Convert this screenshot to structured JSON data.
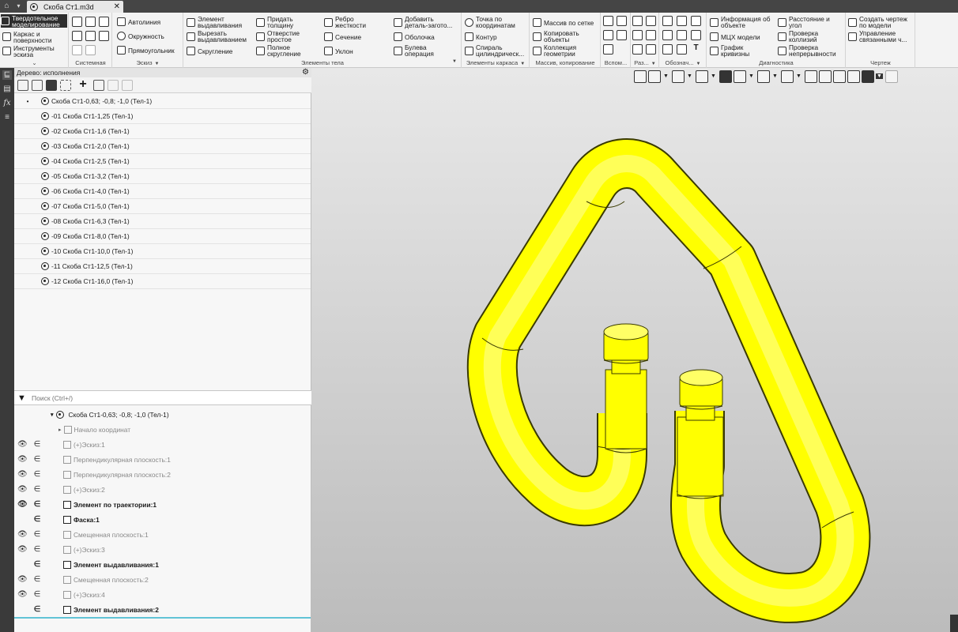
{
  "tabbar": {
    "home_icon": "home-icon",
    "doc_title": "Скоба Ст1.m3d",
    "close": "✕"
  },
  "ribbon": {
    "modes": {
      "m1": "Твердотельное моделирование",
      "m2": "Каркас и поверхности",
      "m3": "Инструменты эскиза"
    },
    "system": {
      "label": "Системная"
    },
    "sketch": {
      "autoline": "Автолиния",
      "circle": "Окружность",
      "rect": "Прямоугольник",
      "label": "Эскиз"
    },
    "body": {
      "extrude": "Элемент выдавливания",
      "cut": "Вырезать выдавливанием",
      "fillet": "Скругление",
      "thicken": "Придать толщину",
      "hole": "Отверстие простое",
      "full_fillet": "Полное скругление",
      "rib": "Ребро жесткости",
      "section": "Сечение",
      "draft": "Уклон",
      "add_blank": "Добавить деталь-загото...",
      "shell": "Оболочка",
      "boolean": "Булева операция",
      "label": "Элементы тела"
    },
    "wire": {
      "point": "Точка по координатам",
      "contour": "Контур",
      "spiral": "Спираль цилиндрическ...",
      "label": "Элементы каркаса"
    },
    "array": {
      "grid": "Массив по сетке",
      "copy": "Копировать объекты",
      "collection": "Коллекция геометрии",
      "label": "Массив, копирование"
    },
    "aux": {
      "label": "Вспом..."
    },
    "sizes": {
      "label": "Раз..."
    },
    "notes": {
      "label": "Обознач..."
    },
    "diag": {
      "info": "Информация об объекте",
      "mcc": "МЦХ модели",
      "curvature": "График кривизны",
      "distance": "Расстояние и угол",
      "collision": "Проверка коллизий",
      "continuity": "Проверка непрерывности",
      "label": "Диагностика"
    },
    "drawing": {
      "create": "Создать чертеж по модели",
      "manage": "Управление связанными ч...",
      "label": "Чертеж"
    }
  },
  "tree_header": {
    "title": "Дерево: исполнения"
  },
  "variants": [
    {
      "mark": "•",
      "name": "Скоба Ст1-0,63; -0,8; -1,0 (Тел-1)"
    },
    {
      "mark": "",
      "name": "-01 Скоба Ст1-1,25 (Тел-1)"
    },
    {
      "mark": "",
      "name": "-02 Скоба Ст1-1,6 (Тел-1)"
    },
    {
      "mark": "",
      "name": "-03 Скоба Ст1-2,0 (Тел-1)"
    },
    {
      "mark": "",
      "name": "-04 Скоба Ст1-2,5 (Тел-1)"
    },
    {
      "mark": "",
      "name": "-05 Скоба Ст1-3,2 (Тел-1)"
    },
    {
      "mark": "",
      "name": "-06 Скоба Ст1-4,0 (Тел-1)"
    },
    {
      "mark": "",
      "name": "-07 Скоба Ст1-5,0 (Тел-1)"
    },
    {
      "mark": "",
      "name": "-08 Скоба Ст1-6,3 (Тел-1)"
    },
    {
      "mark": "",
      "name": "-09 Скоба Ст1-8,0 (Тел-1)"
    },
    {
      "mark": "",
      "name": "-10 Скоба Ст1-10,0 (Тел-1)"
    },
    {
      "mark": "",
      "name": "-11 Скоба Ст1-12,5 (Тел-1)"
    },
    {
      "mark": "",
      "name": "-12 Скоба Ст1-16,0 (Тел-1)"
    }
  ],
  "search": {
    "placeholder": "Поиск (Ctrl+/)"
  },
  "tree": {
    "root": "Скоба Ст1-0,63; -0,8; -1,0 (Тел-1)",
    "items": [
      {
        "label": "Начало координат",
        "bold": false,
        "eye": "",
        "elem": ""
      },
      {
        "label": "(+)Эскиз:1",
        "bold": false,
        "eye": "👁",
        "elem": "∈"
      },
      {
        "label": "Перпендикулярная плоскость:1",
        "bold": false,
        "eye": "👁",
        "elem": "∈"
      },
      {
        "label": "Перпендикулярная плоскость:2",
        "bold": false,
        "eye": "👁",
        "elem": "∈"
      },
      {
        "label": "(+)Эскиз:2",
        "bold": false,
        "eye": "👁",
        "elem": "∈"
      },
      {
        "label": "Элемент по траектории:1",
        "bold": true,
        "eye": "👁",
        "elem": "∈"
      },
      {
        "label": "Фаска:1",
        "bold": true,
        "eye": "",
        "elem": "∈"
      },
      {
        "label": "Смещенная плоскость:1",
        "bold": false,
        "eye": "👁",
        "elem": "∈"
      },
      {
        "label": "(+)Эскиз:3",
        "bold": false,
        "eye": "👁",
        "elem": "∈"
      },
      {
        "label": "Элемент выдавливания:1",
        "bold": true,
        "eye": "",
        "elem": "∈"
      },
      {
        "label": "Смещенная плоскость:2",
        "bold": false,
        "eye": "👁",
        "elem": "∈"
      },
      {
        "label": "(+)Эскиз:4",
        "bold": false,
        "eye": "👁",
        "elem": "∈"
      },
      {
        "label": "Элемент выдавливания:2",
        "bold": true,
        "eye": "",
        "elem": "∈"
      }
    ]
  },
  "colors": {
    "model_fill": "#ffff00",
    "model_shade": "#c9c900",
    "model_edge": "#3a3a00"
  }
}
